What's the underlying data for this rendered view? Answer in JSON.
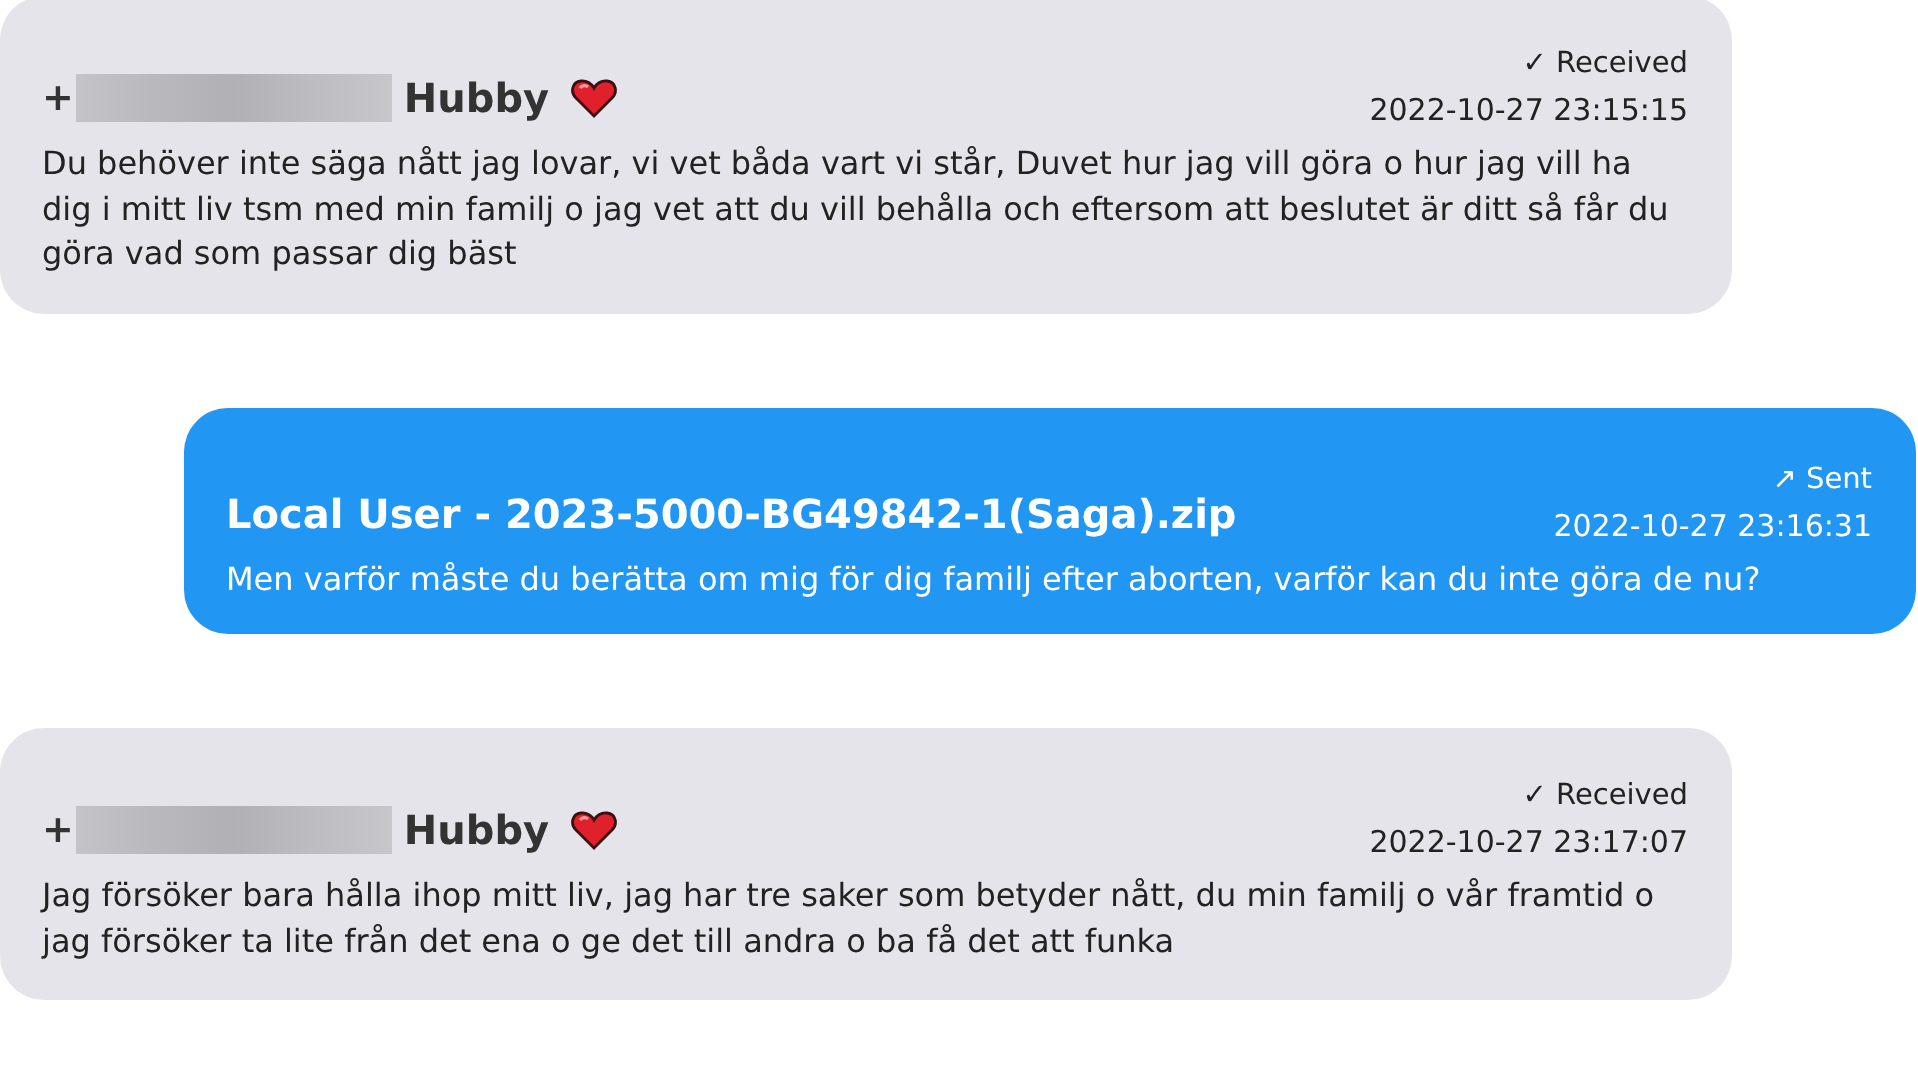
{
  "messages": [
    {
      "kind": "received",
      "status": "✓ Received",
      "sender_prefix": "+",
      "sender_redacted": true,
      "sender": "Hubby",
      "heart": true,
      "timestamp": "2022-10-27 23:15:15",
      "body": "Du behöver inte säga nått jag lovar, vi vet båda vart vi står, Duvet hur jag vill göra o hur jag vill ha dig i mitt liv tsm med min familj o jag vet att du vill behålla och eftersom att beslutet är ditt så får du göra vad som passar dig bäst"
    },
    {
      "kind": "sent",
      "status": "↗ Sent",
      "sender": "Local User - 2023-5000-BG49842-1(Saga).zip",
      "heart": false,
      "timestamp": "2022-10-27 23:16:31",
      "body": "Men varför måste du berätta om mig för dig familj efter aborten, varför kan du inte göra de nu?"
    },
    {
      "kind": "received",
      "status": "✓ Received",
      "sender_prefix": "+",
      "sender_redacted": true,
      "sender": "Hubby",
      "heart": true,
      "timestamp": "2022-10-27 23:17:07",
      "body": "Jag försöker bara hålla ihop mitt liv, jag har tre saker som betyder nått, du min familj o vår framtid o jag försöker ta lite från det ena o ge det till andra o ba få det att funka"
    }
  ]
}
